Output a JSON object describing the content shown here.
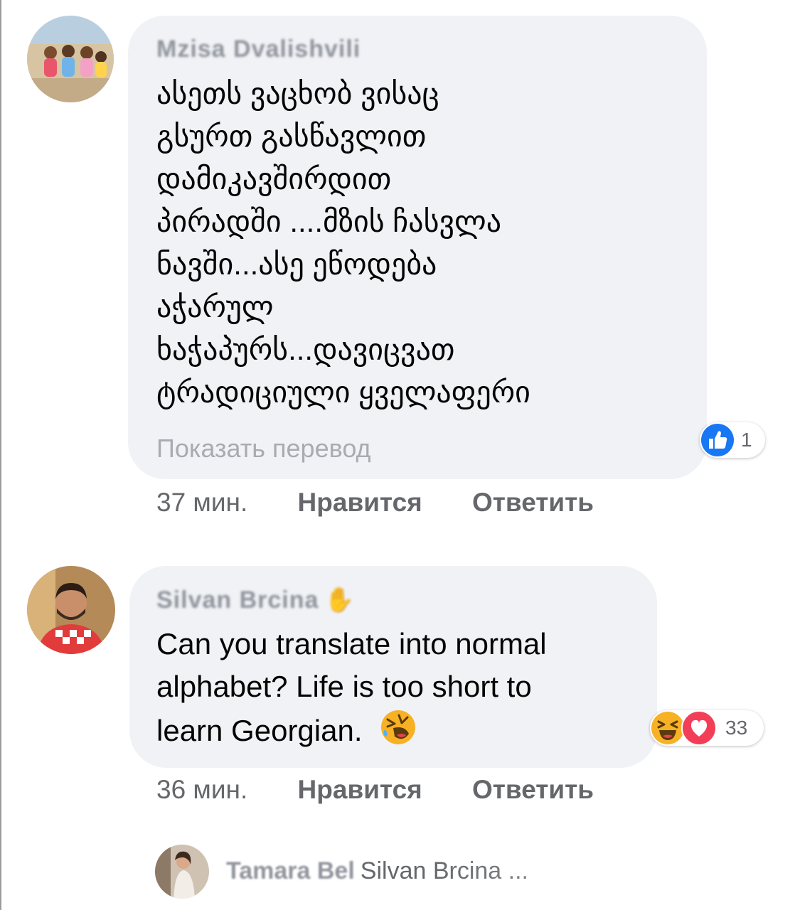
{
  "comments": [
    {
      "author": "Mzisa Dvalishvili",
      "lines": [
        "ასეთს ვაცხობ   ვისაც",
        "გსურთ გასწავლით",
        "დამიკავშირდით",
        "პირადში ....მზის ჩასვლა",
        "ნავში...ასე ეწოდება",
        "აჭარულ",
        "ხაჭაპურს...დავიცვათ",
        "ტრადიციული ყველაფერი"
      ],
      "translate_link": "Показать перевод",
      "reactions": {
        "icons": [
          "like-icon"
        ],
        "count": "1"
      },
      "time": "37 мин.",
      "like_label": "Нравится",
      "reply_label": "Ответить"
    },
    {
      "author": "Silvan Brcina",
      "lines": [
        "Can you translate into normal",
        "alphabet? Life is too short to",
        "learn Georgian."
      ],
      "emoji": "rolling-laughing-emoji",
      "reactions": {
        "icons": [
          "haha-icon",
          "love-icon"
        ],
        "count": "33"
      },
      "time": "36 мин.",
      "like_label": "Нравится",
      "reply_label": "Ответить"
    }
  ],
  "reply_preview": {
    "author": "Tamara Bel",
    "snippet": "Silvan Brcina ..."
  },
  "colors": {
    "bubble": "#f0f2f5",
    "meta_text": "#65676b",
    "like_blue": "#1877f2",
    "love_red": "#f33e58",
    "haha_yellow": "#f7b125"
  }
}
